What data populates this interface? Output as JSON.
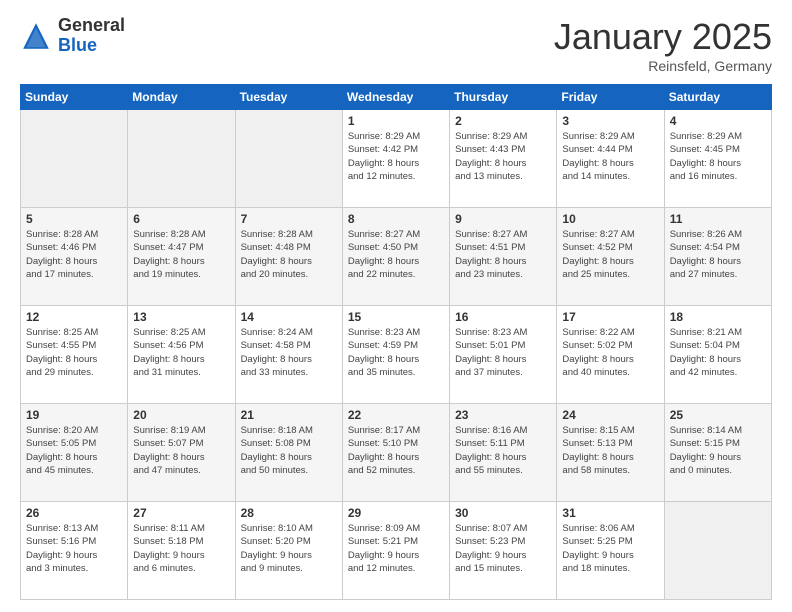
{
  "header": {
    "logo_general": "General",
    "logo_blue": "Blue",
    "month_title": "January 2025",
    "subtitle": "Reinsfeld, Germany"
  },
  "days_of_week": [
    "Sunday",
    "Monday",
    "Tuesday",
    "Wednesday",
    "Thursday",
    "Friday",
    "Saturday"
  ],
  "weeks": [
    [
      {
        "day": "",
        "info": ""
      },
      {
        "day": "",
        "info": ""
      },
      {
        "day": "",
        "info": ""
      },
      {
        "day": "1",
        "info": "Sunrise: 8:29 AM\nSunset: 4:42 PM\nDaylight: 8 hours\nand 12 minutes."
      },
      {
        "day": "2",
        "info": "Sunrise: 8:29 AM\nSunset: 4:43 PM\nDaylight: 8 hours\nand 13 minutes."
      },
      {
        "day": "3",
        "info": "Sunrise: 8:29 AM\nSunset: 4:44 PM\nDaylight: 8 hours\nand 14 minutes."
      },
      {
        "day": "4",
        "info": "Sunrise: 8:29 AM\nSunset: 4:45 PM\nDaylight: 8 hours\nand 16 minutes."
      }
    ],
    [
      {
        "day": "5",
        "info": "Sunrise: 8:28 AM\nSunset: 4:46 PM\nDaylight: 8 hours\nand 17 minutes."
      },
      {
        "day": "6",
        "info": "Sunrise: 8:28 AM\nSunset: 4:47 PM\nDaylight: 8 hours\nand 19 minutes."
      },
      {
        "day": "7",
        "info": "Sunrise: 8:28 AM\nSunset: 4:48 PM\nDaylight: 8 hours\nand 20 minutes."
      },
      {
        "day": "8",
        "info": "Sunrise: 8:27 AM\nSunset: 4:50 PM\nDaylight: 8 hours\nand 22 minutes."
      },
      {
        "day": "9",
        "info": "Sunrise: 8:27 AM\nSunset: 4:51 PM\nDaylight: 8 hours\nand 23 minutes."
      },
      {
        "day": "10",
        "info": "Sunrise: 8:27 AM\nSunset: 4:52 PM\nDaylight: 8 hours\nand 25 minutes."
      },
      {
        "day": "11",
        "info": "Sunrise: 8:26 AM\nSunset: 4:54 PM\nDaylight: 8 hours\nand 27 minutes."
      }
    ],
    [
      {
        "day": "12",
        "info": "Sunrise: 8:25 AM\nSunset: 4:55 PM\nDaylight: 8 hours\nand 29 minutes."
      },
      {
        "day": "13",
        "info": "Sunrise: 8:25 AM\nSunset: 4:56 PM\nDaylight: 8 hours\nand 31 minutes."
      },
      {
        "day": "14",
        "info": "Sunrise: 8:24 AM\nSunset: 4:58 PM\nDaylight: 8 hours\nand 33 minutes."
      },
      {
        "day": "15",
        "info": "Sunrise: 8:23 AM\nSunset: 4:59 PM\nDaylight: 8 hours\nand 35 minutes."
      },
      {
        "day": "16",
        "info": "Sunrise: 8:23 AM\nSunset: 5:01 PM\nDaylight: 8 hours\nand 37 minutes."
      },
      {
        "day": "17",
        "info": "Sunrise: 8:22 AM\nSunset: 5:02 PM\nDaylight: 8 hours\nand 40 minutes."
      },
      {
        "day": "18",
        "info": "Sunrise: 8:21 AM\nSunset: 5:04 PM\nDaylight: 8 hours\nand 42 minutes."
      }
    ],
    [
      {
        "day": "19",
        "info": "Sunrise: 8:20 AM\nSunset: 5:05 PM\nDaylight: 8 hours\nand 45 minutes."
      },
      {
        "day": "20",
        "info": "Sunrise: 8:19 AM\nSunset: 5:07 PM\nDaylight: 8 hours\nand 47 minutes."
      },
      {
        "day": "21",
        "info": "Sunrise: 8:18 AM\nSunset: 5:08 PM\nDaylight: 8 hours\nand 50 minutes."
      },
      {
        "day": "22",
        "info": "Sunrise: 8:17 AM\nSunset: 5:10 PM\nDaylight: 8 hours\nand 52 minutes."
      },
      {
        "day": "23",
        "info": "Sunrise: 8:16 AM\nSunset: 5:11 PM\nDaylight: 8 hours\nand 55 minutes."
      },
      {
        "day": "24",
        "info": "Sunrise: 8:15 AM\nSunset: 5:13 PM\nDaylight: 8 hours\nand 58 minutes."
      },
      {
        "day": "25",
        "info": "Sunrise: 8:14 AM\nSunset: 5:15 PM\nDaylight: 9 hours\nand 0 minutes."
      }
    ],
    [
      {
        "day": "26",
        "info": "Sunrise: 8:13 AM\nSunset: 5:16 PM\nDaylight: 9 hours\nand 3 minutes."
      },
      {
        "day": "27",
        "info": "Sunrise: 8:11 AM\nSunset: 5:18 PM\nDaylight: 9 hours\nand 6 minutes."
      },
      {
        "day": "28",
        "info": "Sunrise: 8:10 AM\nSunset: 5:20 PM\nDaylight: 9 hours\nand 9 minutes."
      },
      {
        "day": "29",
        "info": "Sunrise: 8:09 AM\nSunset: 5:21 PM\nDaylight: 9 hours\nand 12 minutes."
      },
      {
        "day": "30",
        "info": "Sunrise: 8:07 AM\nSunset: 5:23 PM\nDaylight: 9 hours\nand 15 minutes."
      },
      {
        "day": "31",
        "info": "Sunrise: 8:06 AM\nSunset: 5:25 PM\nDaylight: 9 hours\nand 18 minutes."
      },
      {
        "day": "",
        "info": ""
      }
    ]
  ]
}
